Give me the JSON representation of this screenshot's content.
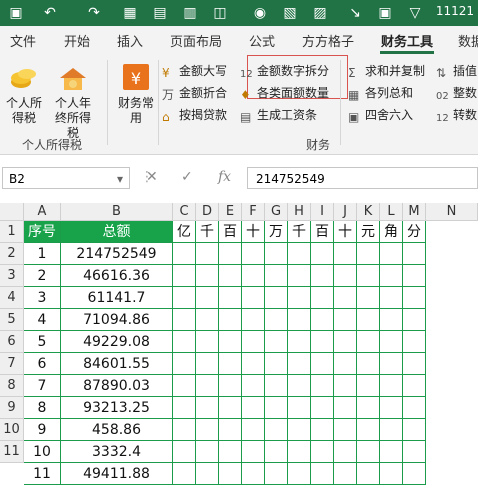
{
  "title_bar": {
    "title": "11121"
  },
  "tabs": [
    "文件",
    "开始",
    "插入",
    "页面布局",
    "公式",
    "方方格子",
    "财务工具",
    "数据"
  ],
  "ribbon": {
    "personal_tax": {
      "btn1": "个人所得税",
      "btn2": "个人年终所得税",
      "group": "个人所得税"
    },
    "finance_common": "财务常用",
    "col1": [
      "金额大写",
      "金额折合",
      "按揭贷款"
    ],
    "col2": [
      "金额数字拆分",
      "各类面额数量",
      "生成工资条"
    ],
    "col3": [
      "求和并复制",
      "各列总和",
      "四舍六入"
    ],
    "col4": [
      "插值",
      "整数",
      "转数"
    ],
    "group_finance": "财务"
  },
  "formula_bar": {
    "name_box": "B2",
    "fx": "fx",
    "value": "214752549"
  },
  "columns": [
    "A",
    "B",
    "C",
    "D",
    "E",
    "F",
    "G",
    "H",
    "I",
    "J",
    "K",
    "L",
    "M",
    "N"
  ],
  "header_row": [
    "序号",
    "总额",
    "亿",
    "千",
    "百",
    "十",
    "万",
    "千",
    "百",
    "十",
    "元",
    "角",
    "分"
  ],
  "rows": [
    {
      "num": "1",
      "val": "214752549"
    },
    {
      "num": "2",
      "val": "46616.36"
    },
    {
      "num": "3",
      "val": "61141.7"
    },
    {
      "num": "4",
      "val": "71094.86"
    },
    {
      "num": "5",
      "val": "49229.08"
    },
    {
      "num": "6",
      "val": "84601.55"
    },
    {
      "num": "7",
      "val": "87890.03"
    },
    {
      "num": "8",
      "val": "93213.25"
    },
    {
      "num": "9",
      "val": "458.86"
    },
    {
      "num": "10",
      "val": "3332.4"
    },
    {
      "num": "11",
      "val": "49411.88"
    }
  ],
  "row_numbers": [
    "1",
    "2",
    "3",
    "4",
    "5",
    "6",
    "7",
    "8",
    "9",
    "10",
    "11"
  ]
}
